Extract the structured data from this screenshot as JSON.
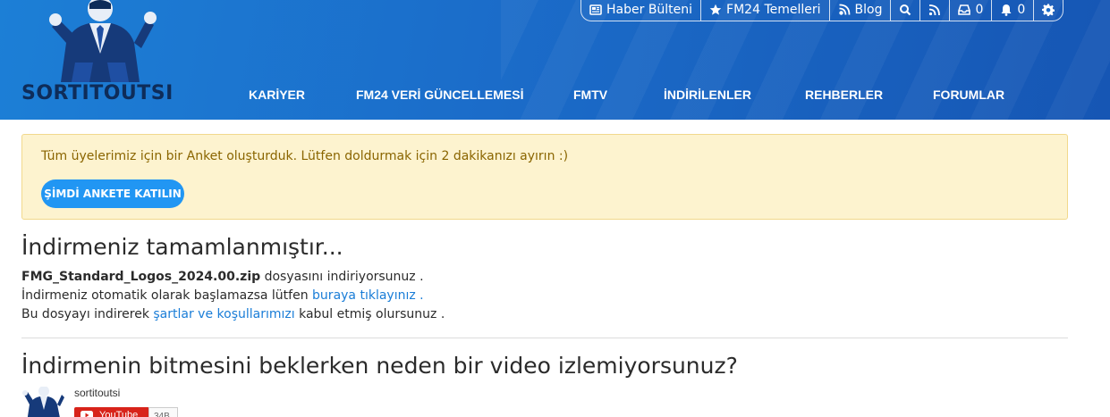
{
  "brand": {
    "logo_text": "SORTITOUTSI",
    "colors": {
      "header_start": "#1c7fd6",
      "header_end": "#1656b4",
      "accent": "#2196f3",
      "link": "#1a7dd7",
      "notice_bg": "#fdf3cf"
    }
  },
  "utility_bar": [
    {
      "icon": "newsletter-icon",
      "label": "Haber Bülteni"
    },
    {
      "icon": "star-icon",
      "label": "FM24 Temelleri"
    },
    {
      "icon": "blog-icon",
      "label": "Blog"
    },
    {
      "icon": "search-icon",
      "label": ""
    },
    {
      "icon": "rss-icon",
      "label": ""
    },
    {
      "icon": "inbox-icon",
      "label": "0"
    },
    {
      "icon": "bell-icon",
      "label": "0"
    },
    {
      "icon": "gear-icon",
      "label": ""
    }
  ],
  "nav": [
    {
      "label": "KARİYER"
    },
    {
      "label": "FM24 VERİ GÜNCELLEMESİ"
    },
    {
      "label": "FMTV"
    },
    {
      "label": "İNDİRİLENLER"
    },
    {
      "label": "REHBERLER"
    },
    {
      "label": "FORUMLAR"
    }
  ],
  "notice": {
    "text": "Tüm üyelerimiz için bir Anket oluşturduk. Lütfen doldurmak için 2 dakikanızı ayırın :)",
    "button": "ŞİMDİ ANKETE KATILIN"
  },
  "download": {
    "heading": "İndirmeniz tamamlanmıştır...",
    "file_name": "FMG_Standard_Logos_2024.00.zip",
    "line1_suffix": " dosyasını indiriyorsunuz .",
    "line2_prefix": "İndirmeniz otomatik olarak başlamazsa lütfen ",
    "line2_link": "buraya tıklayınız .",
    "line3_prefix": "Bu dosyayı indirerek ",
    "line3_link": "şartlar ve koşullarımızı",
    "line3_suffix": " kabul etmiş olursunuz ."
  },
  "video": {
    "heading": "İndirmenin bitmesini beklerken neden bir video izlemiyorsunuz?",
    "channel_name": "sortitoutsi",
    "subscribe_label": "YouTube",
    "subscriber_count": "34B"
  }
}
